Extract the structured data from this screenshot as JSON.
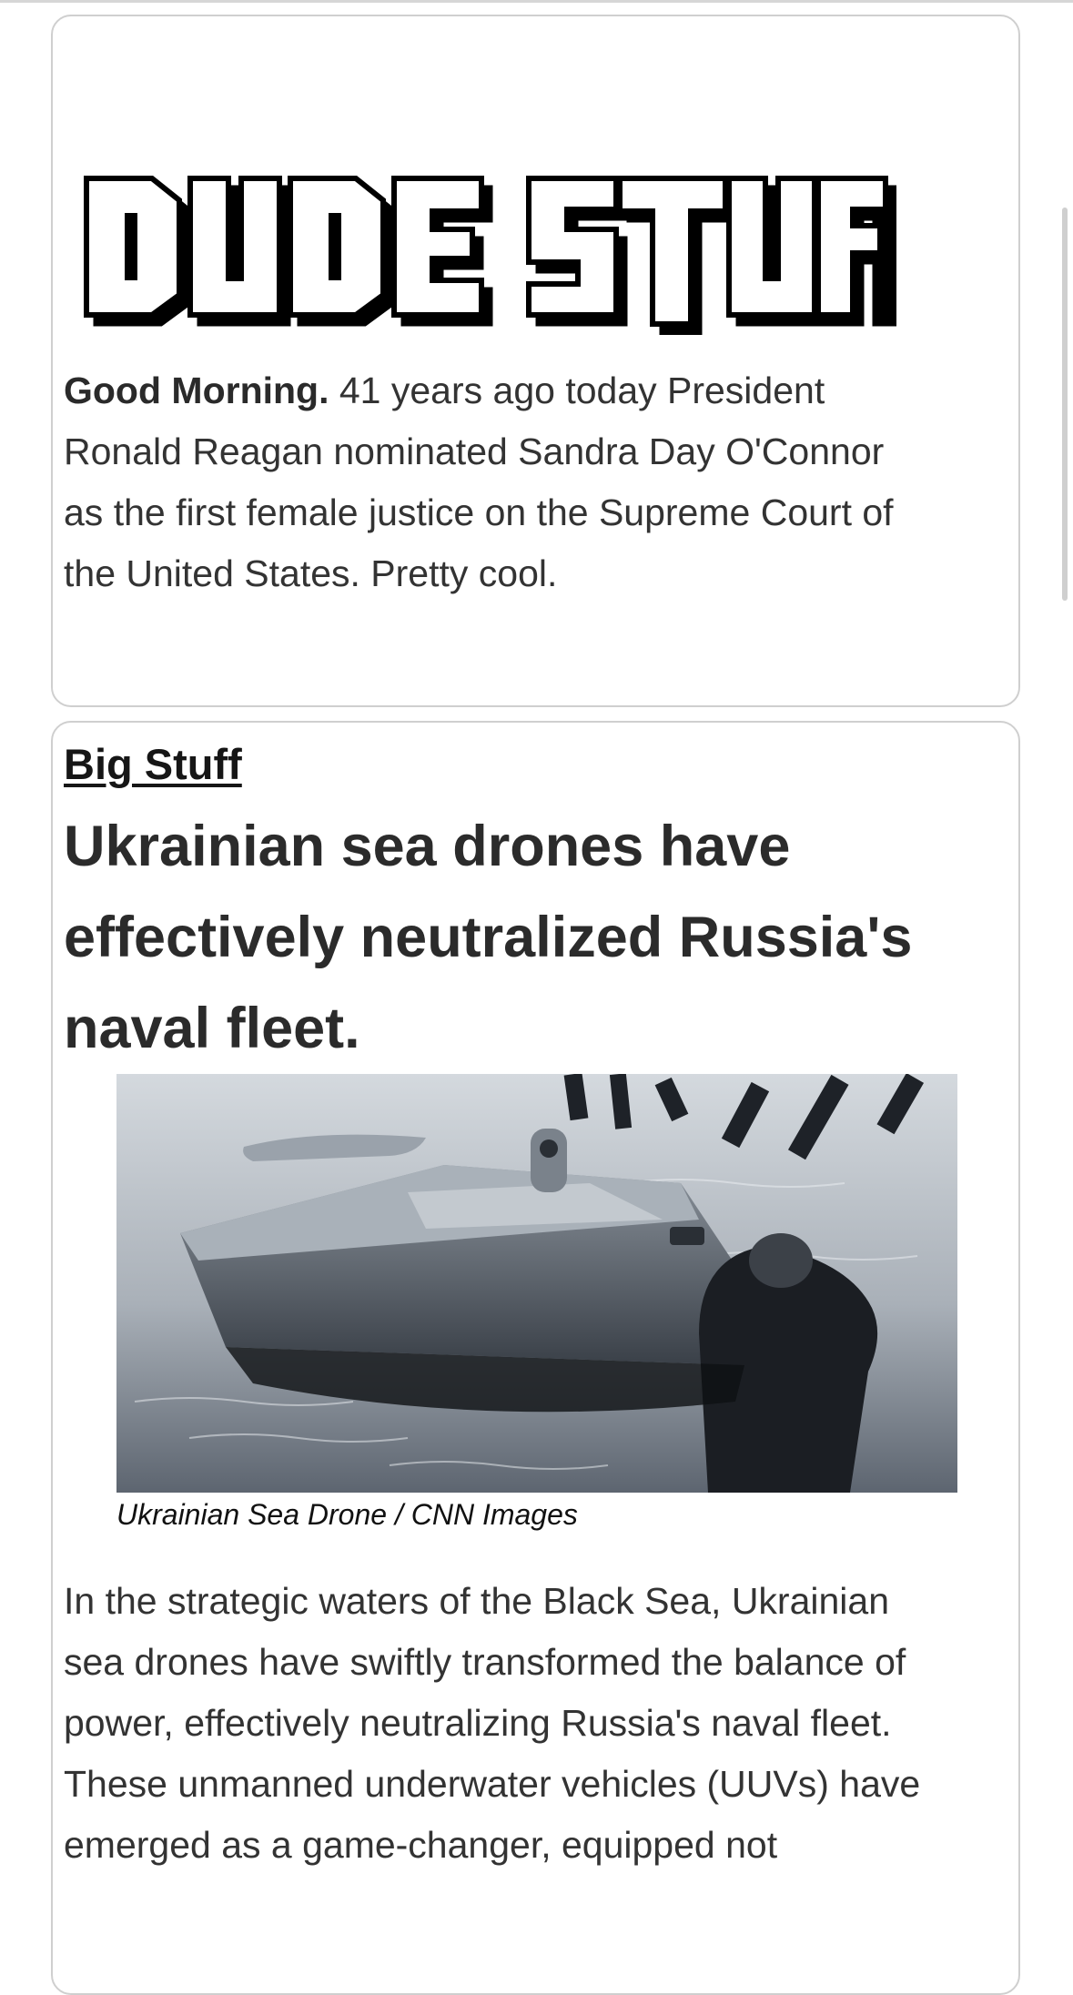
{
  "newsletter": {
    "logo_text": "DUDE STUFF",
    "greeting": "Good Morning.",
    "intro_text": " 41 years ago today President Ronald Reagan nominated Sandra Day O'Connor as the first female justice on the Supreme Court of the United States. Pretty cool."
  },
  "article": {
    "section_label": "Big Stuff",
    "headline": "Ukrainian sea drones have effectively neutralized Russia's naval fleet.",
    "image_caption": "Ukrainian Sea Drone / CNN Images",
    "body": "In the strategic waters of the Black Sea, Ukrainian sea drones have swiftly transformed the balance of power, effectively neutralizing Russia's naval fleet. These unmanned underwater vehicles (UUVs) have emerged as a game-changer, equipped not"
  },
  "colors": {
    "card_border": "#cfcfcf",
    "text": "#333333",
    "heading": "#2b2b2b"
  }
}
